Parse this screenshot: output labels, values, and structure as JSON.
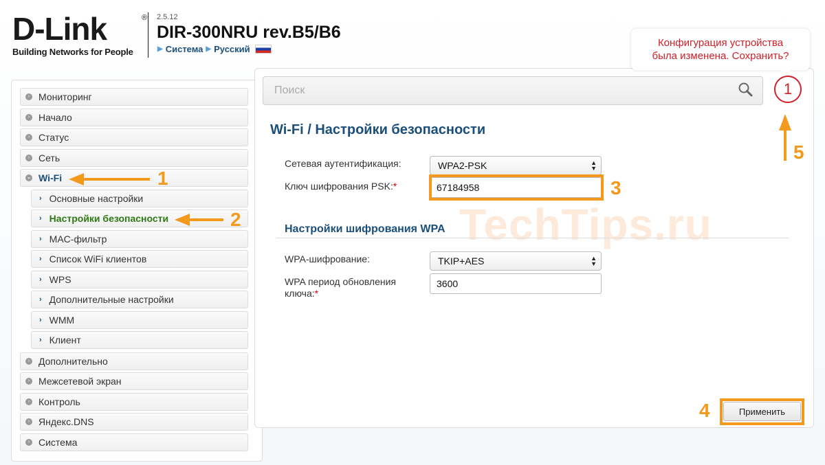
{
  "header": {
    "logo_text": "D-Link",
    "logo_reg": "®",
    "logo_tagline": "Building Networks for People",
    "firmware": "2.5.12",
    "model": "DIR-300NRU rev.B5/B6",
    "crumb_system": "Система",
    "crumb_language": "Русский",
    "language_flag": "russian-flag"
  },
  "notification": {
    "text_line1": "Конфигурация устройства",
    "text_line2": "была изменена. Сохранить?",
    "badge": "1"
  },
  "search": {
    "placeholder": "Поиск"
  },
  "sidebar": {
    "items": [
      {
        "label": "Мониторинг"
      },
      {
        "label": "Начало"
      },
      {
        "label": "Статус"
      },
      {
        "label": "Сеть"
      },
      {
        "label": "Wi-Fi"
      },
      {
        "label": "Основные настройки"
      },
      {
        "label": "Настройки безопасности"
      },
      {
        "label": "MAC-фильтр"
      },
      {
        "label": "Список WiFi клиентов"
      },
      {
        "label": "WPS"
      },
      {
        "label": "Дополнительные настройки"
      },
      {
        "label": "WMM"
      },
      {
        "label": "Клиент"
      },
      {
        "label": "Дополнительно"
      },
      {
        "label": "Межсетевой экран"
      },
      {
        "label": "Контроль"
      },
      {
        "label": "Яндекс.DNS"
      },
      {
        "label": "Система"
      }
    ]
  },
  "main": {
    "title": "Wi-Fi /  Настройки безопасности",
    "auth_label": "Сетевая аутентификация:",
    "auth_value": "WPA2-PSK",
    "psk_label": "Ключ шифрования PSK:",
    "psk_value": "67184958",
    "wpa_section_title": "Настройки шифрования WPA",
    "wpa_enc_label": "WPA-шифрование:",
    "wpa_enc_value": "TKIP+AES",
    "wpa_period_label_line1": "WPA период обновления",
    "wpa_period_label_line2": "ключа:",
    "wpa_period_value": "3600",
    "required_mark": "*",
    "apply_label": "Применить",
    "watermark": "TechTips.ru"
  },
  "annotations": {
    "n1": "1",
    "n2": "2",
    "n3": "3",
    "n4": "4",
    "n5": "5",
    "color": "#f39a1e"
  },
  "colors": {
    "accent": "#1b4f7a",
    "active_green": "#2d7a14",
    "alert_red": "#d0202a",
    "annotation_orange": "#f39a1e"
  }
}
